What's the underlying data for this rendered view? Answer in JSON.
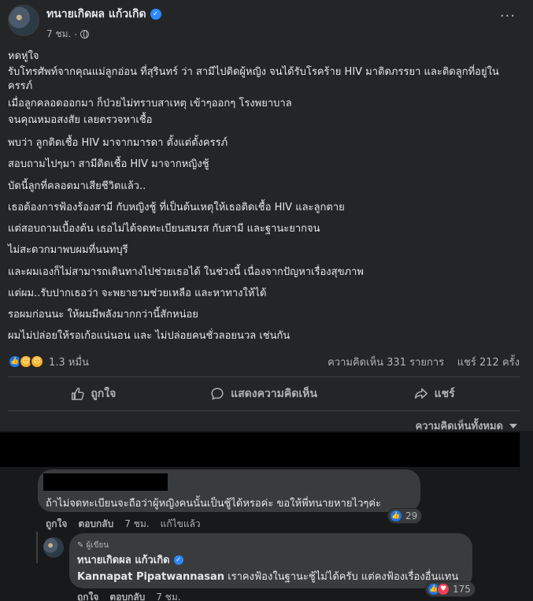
{
  "post": {
    "author": "ทนายเกิดผล แก้วเกิด",
    "time": "7 ชม.",
    "dot": "·",
    "more": "···",
    "paragraphs": [
      "หดหู่ใจ",
      "รับโทรศัพท์จากคุณแม่ลูกอ่อน ที่สุรินทร์ ว่า สามีไปติดผู้หญิง จนได้รับโรคร้าย HIV มาติดภรรยา และติดลูกที่อยู่ในครรภ์",
      "เมื่อลูกคลอดออกมา ก็ป่วยไม่ทราบสาเหตุ เข้าๆออกๆ โรงพยาบาล",
      "จนคุณหมอสงสัย เลยตรวจหาเชื้อ",
      "พบว่า ลูกติดเชื้อ HIV มาจากมารดา ตั้งแต่ตั้งครรภ์",
      "สอบถามไปๆมา สามีติดเชื้อ HIV มาจากหญิงชู้",
      "บัดนี้ลูกที่คลอดมาเสียชีวิตแล้ว..",
      "เธอต้องการฟ้องร้องสามี กับหญิงชู้ ที่เป็นต้นเหตุให้เธอติดเชื้อ HIV และลูกตาย",
      "แต่สอบถามเบื้องต้น เธอไม่ได้จดทะเบียนสมรส กับสามี และฐานะยากจน",
      "ไม่สะดวกมาพบผมที่นนทบุรี",
      "และผมเองก็ไม่สามารถเดินทางไปช่วยเธอได้ ในช่วงนี้ เนื่องจากปัญหาเรื่องสุขภาพ",
      "แต่ผม..รับปากเธอว่า จะพยายามช่วยเหลือ และหาทางให้ได้",
      "รอผมก่อนนะ ให้ผมมีพลังมากกว่านี้สักหน่อย",
      "ผมไม่ปล่อยให้รอเก้อแน่นอน และ ไม่ปล่อยคนชั่วลอยนวล เช่นกัน"
    ],
    "reaction_count": "1.3 หมื่น",
    "comments_count": "ความคิดเห็น 331 รายการ",
    "shares_count": "แชร์ 212 ครั้ง"
  },
  "actions": {
    "like": "ถูกใจ",
    "comment": "แสดงความคิดเห็น",
    "share": "แชร์"
  },
  "comments_filter": "ความคิดเห็นทั้งหมด",
  "comment1": {
    "text": "ถ้าไม่จดทะเบียนจะถือว่าผู้หญิงคนนั้นเป็นชู้ได้หรอค่ะ ขอให้พี่ทนายหายไวๆค่ะ",
    "like": "ถูกใจ",
    "reply": "ตอบกลับ",
    "time": "7 ชม.",
    "edited": "แก้ไขแล้ว",
    "reactions": "29"
  },
  "reply1": {
    "badge": "ผู้เขียน",
    "author": "ทนายเกิดผล แก้วเกิด",
    "mention": "Kannapat Pipatwannasan",
    "text": " เราคงฟ้องในฐานะชู้ไม่ได้ครับ แต่คงฟ้องเรื่องอื่นแทน",
    "like": "ถูกใจ",
    "reply": "ตอบกลับ",
    "time": "7 ชม.",
    "reactions": "175"
  },
  "colors": {
    "background": "#18191a",
    "card": "#242526",
    "bubble": "#3a3b3c",
    "like_blue": "#1877f2",
    "love_red": "#f33e58"
  }
}
